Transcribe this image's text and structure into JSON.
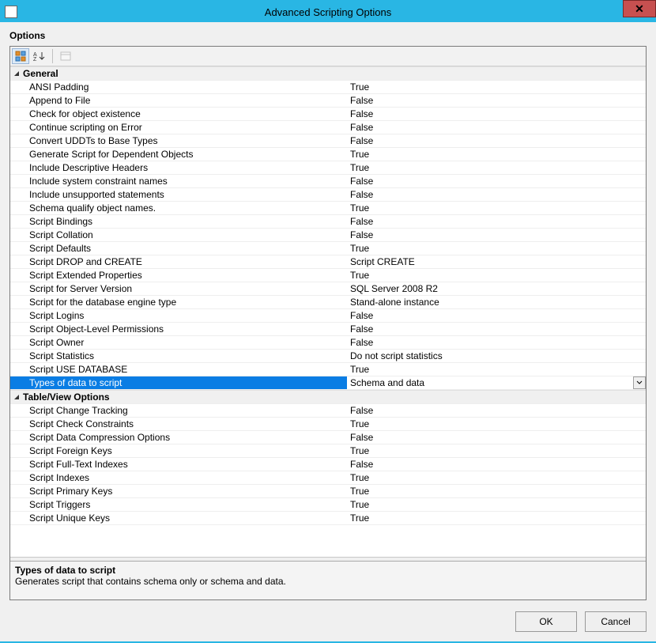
{
  "window": {
    "title": "Advanced Scripting Options"
  },
  "sections": {
    "options_label": "Options"
  },
  "categories": [
    {
      "name": "General",
      "rows": [
        {
          "label": "ANSI Padding",
          "value": "True"
        },
        {
          "label": "Append to File",
          "value": "False"
        },
        {
          "label": "Check for object existence",
          "value": "False"
        },
        {
          "label": "Continue scripting on Error",
          "value": "False"
        },
        {
          "label": "Convert UDDTs to Base Types",
          "value": "False"
        },
        {
          "label": "Generate Script for Dependent Objects",
          "value": "True"
        },
        {
          "label": "Include Descriptive Headers",
          "value": "True"
        },
        {
          "label": "Include system constraint names",
          "value": "False"
        },
        {
          "label": "Include unsupported statements",
          "value": "False"
        },
        {
          "label": "Schema qualify object names.",
          "value": "True"
        },
        {
          "label": "Script Bindings",
          "value": "False"
        },
        {
          "label": "Script Collation",
          "value": "False"
        },
        {
          "label": "Script Defaults",
          "value": "True"
        },
        {
          "label": "Script DROP and CREATE",
          "value": "Script CREATE"
        },
        {
          "label": "Script Extended Properties",
          "value": "True"
        },
        {
          "label": "Script for Server Version",
          "value": "SQL Server 2008 R2"
        },
        {
          "label": "Script for the database engine type",
          "value": "Stand-alone instance"
        },
        {
          "label": "Script Logins",
          "value": "False"
        },
        {
          "label": "Script Object-Level Permissions",
          "value": "False"
        },
        {
          "label": "Script Owner",
          "value": "False"
        },
        {
          "label": "Script Statistics",
          "value": "Do not script statistics"
        },
        {
          "label": "Script USE DATABASE",
          "value": "True"
        },
        {
          "label": "Types of data to script",
          "value": "Schema and data",
          "selected": true
        }
      ]
    },
    {
      "name": "Table/View Options",
      "rows": [
        {
          "label": "Script Change Tracking",
          "value": "False"
        },
        {
          "label": "Script Check Constraints",
          "value": "True"
        },
        {
          "label": "Script Data Compression Options",
          "value": "False"
        },
        {
          "label": "Script Foreign Keys",
          "value": "True"
        },
        {
          "label": "Script Full-Text Indexes",
          "value": "False"
        },
        {
          "label": "Script Indexes",
          "value": "True"
        },
        {
          "label": "Script Primary Keys",
          "value": "True"
        },
        {
          "label": "Script Triggers",
          "value": "True"
        },
        {
          "label": "Script Unique Keys",
          "value": "True"
        }
      ]
    }
  ],
  "description": {
    "title": "Types of data to script",
    "text": "Generates script that contains schema only or schema and data."
  },
  "buttons": {
    "ok": "OK",
    "cancel": "Cancel"
  }
}
